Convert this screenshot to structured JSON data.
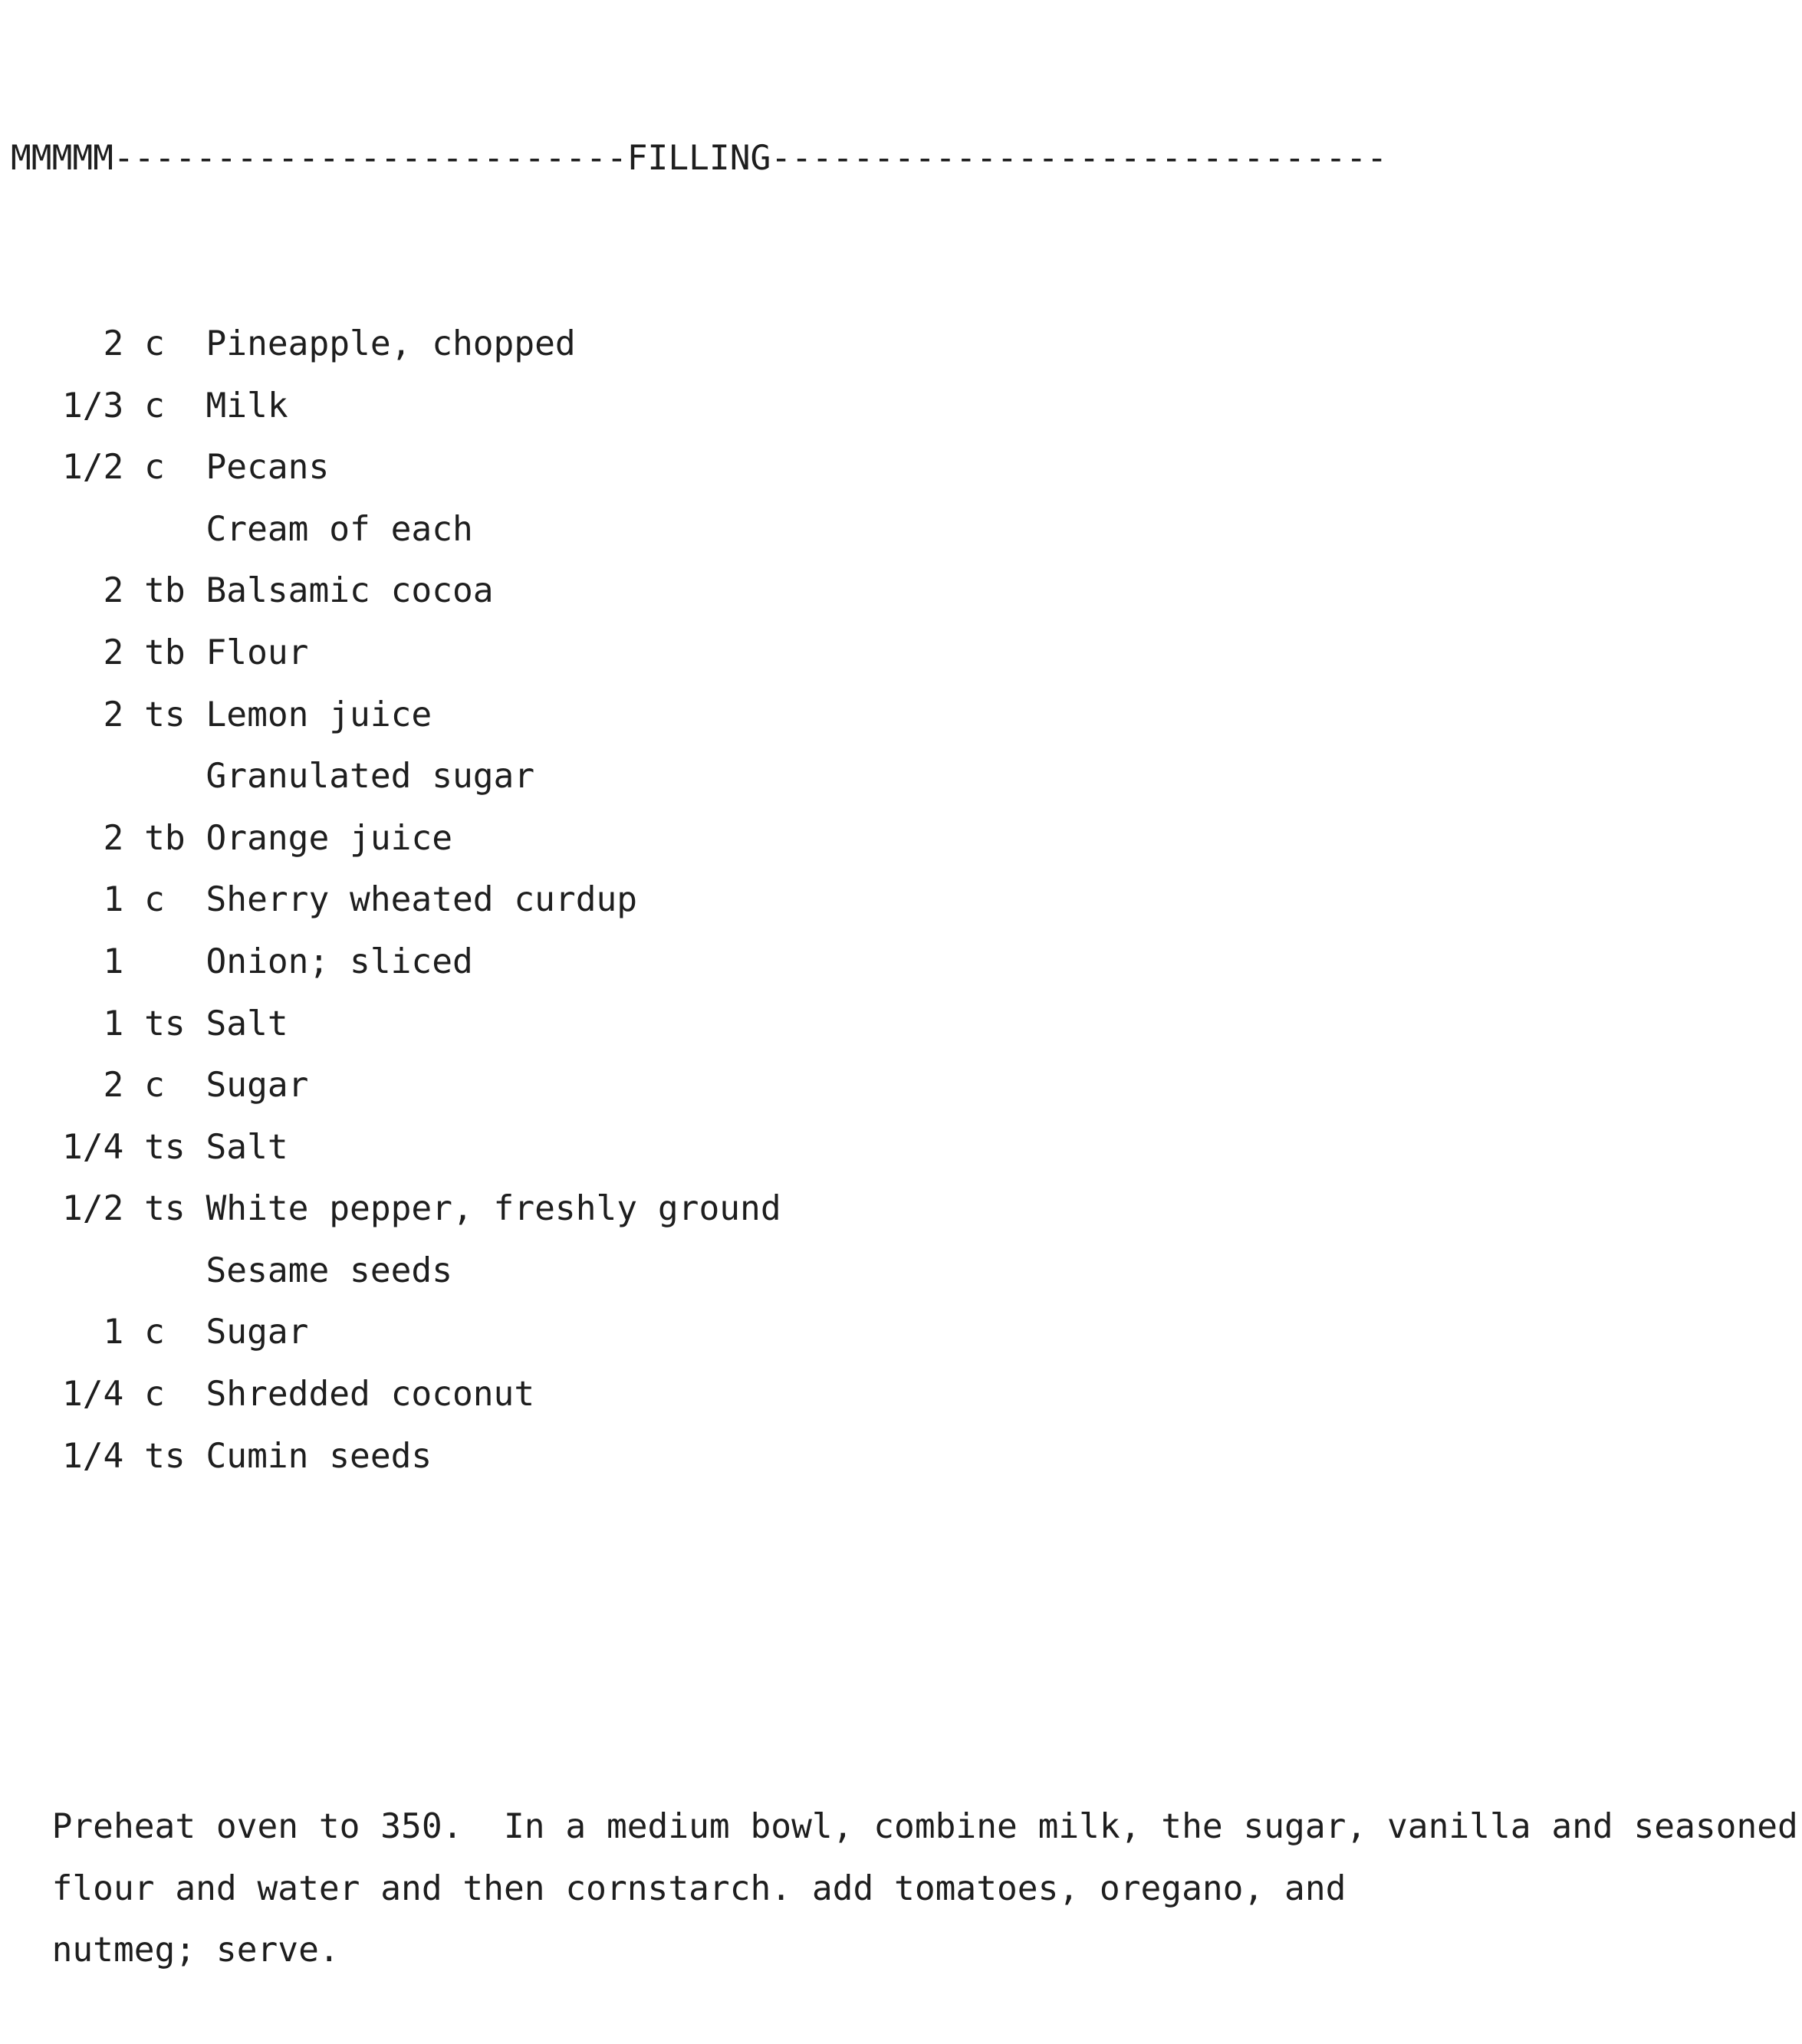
{
  "section_header": "MMMMM-------------------------FILLING------------------------------",
  "ingredients": [
    {
      "qty": "2",
      "unit": "c",
      "item": "Pineapple, chopped"
    },
    {
      "qty": "1/3",
      "unit": "c",
      "item": "Milk"
    },
    {
      "qty": "1/2",
      "unit": "c",
      "item": "Pecans"
    },
    {
      "qty": "",
      "unit": "",
      "item": "Cream of each"
    },
    {
      "qty": "2",
      "unit": "tb",
      "item": "Balsamic cocoa"
    },
    {
      "qty": "2",
      "unit": "tb",
      "item": "Flour"
    },
    {
      "qty": "2",
      "unit": "ts",
      "item": "Lemon juice"
    },
    {
      "qty": "",
      "unit": "",
      "item": "Granulated sugar"
    },
    {
      "qty": "2",
      "unit": "tb",
      "item": "Orange juice"
    },
    {
      "qty": "1",
      "unit": "c",
      "item": "Sherry wheated curdup"
    },
    {
      "qty": "1",
      "unit": "",
      "item": "Onion; sliced"
    },
    {
      "qty": "1",
      "unit": "ts",
      "item": "Salt"
    },
    {
      "qty": "2",
      "unit": "c",
      "item": "Sugar"
    },
    {
      "qty": "1/4",
      "unit": "ts",
      "item": "Salt"
    },
    {
      "qty": "1/2",
      "unit": "ts",
      "item": "White pepper, freshly ground"
    },
    {
      "qty": "",
      "unit": "",
      "item": "Sesame seeds"
    },
    {
      "qty": "1",
      "unit": "c",
      "item": "Sugar"
    },
    {
      "qty": "1/4",
      "unit": "c",
      "item": "Shredded coconut"
    },
    {
      "qty": "1/4",
      "unit": "ts",
      "item": "Cumin seeds"
    }
  ],
  "instructions": [
    "  Preheat oven to 350.  In a medium bowl, combine milk, the sugar, vanilla and seasoned",
    "  flour and water and then cornstarch. add tomatoes, oregano, and",
    "  nutmeg; serve."
  ]
}
